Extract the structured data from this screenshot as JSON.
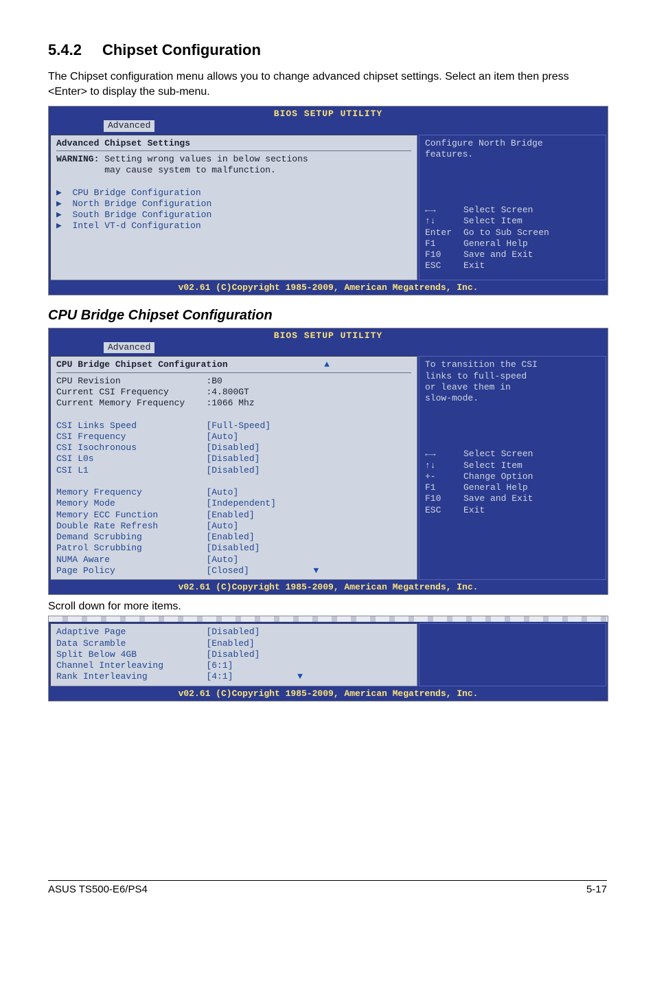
{
  "heading": {
    "num": "5.4.2",
    "title": "Chipset Configuration"
  },
  "intro": "The Chipset configuration menu allows you to change advanced chipset settings. Select an item then press <Enter> to display the sub-menu.",
  "bios1": {
    "title": "BIOS SETUP UTILITY",
    "tab": "Advanced",
    "left_heading": "Advanced Chipset Settings",
    "warning_label": "WARNING:",
    "warning_l1": "Setting wrong values in below sections",
    "warning_l2": "may cause system to malfunction.",
    "menu": [
      "CPU Bridge Configuration",
      "North Bridge Configuration",
      "South Bridge Configuration",
      "Intel VT-d Configuration"
    ],
    "help": "Configure North Bridge\nfeatures.",
    "nav": [
      {
        "k": "←→",
        "t": "Select Screen"
      },
      {
        "k": "↑↓",
        "t": "Select Item"
      },
      {
        "k": "Enter",
        "t": "Go to Sub Screen"
      },
      {
        "k": "F1",
        "t": "General Help"
      },
      {
        "k": "F10",
        "t": "Save and Exit"
      },
      {
        "k": "ESC",
        "t": "Exit"
      }
    ],
    "copyright": "v02.61 (C)Copyright 1985-2009, American Megatrends, Inc."
  },
  "sub_heading": "CPU Bridge Chipset Configuration",
  "bios2": {
    "title": "BIOS SETUP UTILITY",
    "tab": "Advanced",
    "left_heading": "CPU Bridge Chipset Configuration",
    "info_rows": [
      {
        "l": "CPU Revision",
        "v": ":B0"
      },
      {
        "l": "Current CSI Frequency",
        "v": ":4.800GT"
      },
      {
        "l": "Current Memory Frequency",
        "v": ":1066 Mhz"
      }
    ],
    "group1": [
      {
        "l": "CSI Links Speed",
        "v": "[Full-Speed]"
      },
      {
        "l": "CSI Frequency",
        "v": "[Auto]"
      },
      {
        "l": "CSI Isochronous",
        "v": "[Disabled]"
      },
      {
        "l": "CSI L0s",
        "v": "[Disabled]"
      },
      {
        "l": "CSI L1",
        "v": "[Disabled]"
      }
    ],
    "group2": [
      {
        "l": "Memory Frequency",
        "v": "[Auto]"
      },
      {
        "l": "Memory Mode",
        "v": "[Independent]"
      },
      {
        "l": "Memory ECC Function",
        "v": "[Enabled]"
      },
      {
        "l": "Double Rate Refresh",
        "v": "[Auto]"
      },
      {
        "l": "Demand Scrubbing",
        "v": "[Enabled]"
      },
      {
        "l": "Patrol Scrubbing",
        "v": "[Disabled]"
      },
      {
        "l": "NUMA Aware",
        "v": "[Auto]"
      },
      {
        "l": "Page Policy",
        "v": "[Closed]"
      }
    ],
    "help": "To transition the CSI\nlinks to full-speed\nor leave them in\nslow-mode.",
    "nav": [
      {
        "k": "←→",
        "t": "Select Screen"
      },
      {
        "k": "↑↓",
        "t": "Select Item"
      },
      {
        "k": "+-",
        "t": "Change Option"
      },
      {
        "k": "F1",
        "t": "General Help"
      },
      {
        "k": "F10",
        "t": "Save and Exit"
      },
      {
        "k": "ESC",
        "t": "Exit"
      }
    ],
    "copyright": "v02.61 (C)Copyright 1985-2009, American Megatrends, Inc."
  },
  "scroll_note": "Scroll down for more items.",
  "bios3": {
    "rows": [
      {
        "l": "Adaptive Page",
        "v": "[Disabled]"
      },
      {
        "l": "Data Scramble",
        "v": "[Enabled]"
      },
      {
        "l": "Split Below 4GB",
        "v": "[Disabled]"
      },
      {
        "l": "Channel Interleaving",
        "v": "[6:1]"
      },
      {
        "l": "Rank Interleaving",
        "v": "[4:1]"
      }
    ],
    "copyright": "v02.61 (C)Copyright 1985-2009, American Megatrends, Inc."
  },
  "footer": {
    "left": "ASUS TS500-E6/PS4",
    "right": "5-17"
  }
}
